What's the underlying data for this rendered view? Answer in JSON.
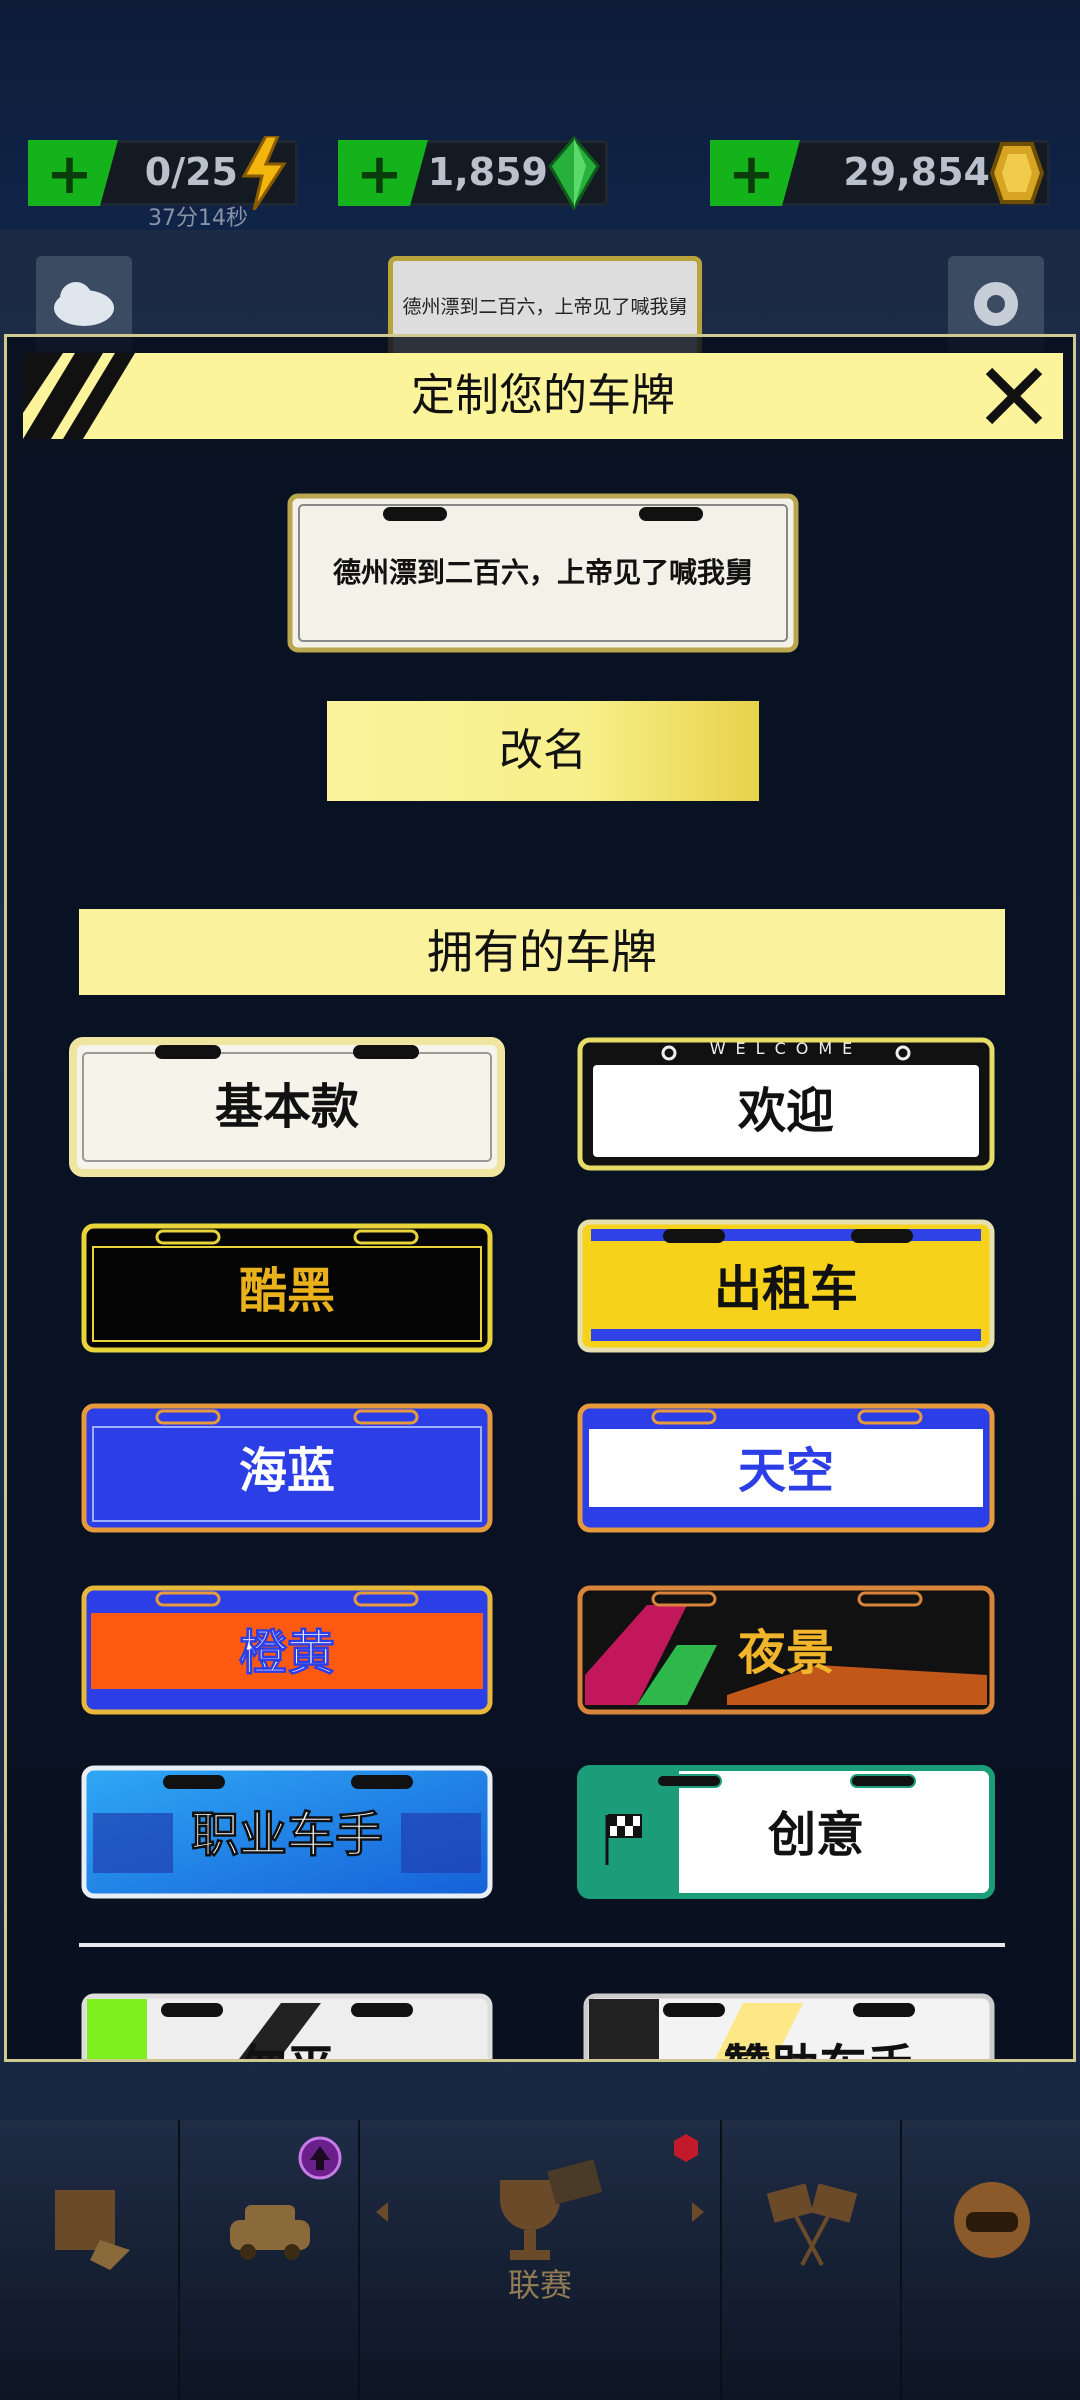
{
  "resources": [
    {
      "value": "0/25",
      "icon": "lightning-icon",
      "timer": "37分14秒"
    },
    {
      "value": "1,859",
      "icon": "green-gem-icon"
    },
    {
      "value": "29,854",
      "icon": "gold-coin-icon"
    }
  ],
  "background": {
    "plate_text": "德州漂到二百六，上帝见了喊我舅"
  },
  "dialog": {
    "title": "定制您的车牌",
    "current_plate_text": "德州漂到二百六，上帝见了喊我舅",
    "rename_label": "改名",
    "section_title": "拥有的车牌",
    "plates": [
      {
        "label": "基本款",
        "style": "basic",
        "selected": true
      },
      {
        "label": "欢迎",
        "style": "welcome",
        "header": "WELCOME"
      },
      {
        "label": "酷黑",
        "style": "black"
      },
      {
        "label": "出租车",
        "style": "taxi"
      },
      {
        "label": "海蓝",
        "style": "sea-blue"
      },
      {
        "label": "天空",
        "style": "sky"
      },
      {
        "label": "橙黄",
        "style": "orange"
      },
      {
        "label": "夜景",
        "style": "night"
      },
      {
        "label": "职业车手",
        "style": "pro-racer"
      },
      {
        "label": "创意",
        "style": "creative"
      }
    ],
    "partial_plates": [
      {
        "label": "勿平",
        "style": "partial-left"
      },
      {
        "label": "赞助车手",
        "style": "sponsor"
      }
    ]
  },
  "nav": {
    "tabs": [
      {
        "name": "shop",
        "icon": "shop-icon"
      },
      {
        "name": "garage",
        "icon": "car-icon"
      },
      {
        "name": "league",
        "icon": "trophy-icon",
        "label": "联赛"
      },
      {
        "name": "race",
        "icon": "checkered-flags-icon"
      },
      {
        "name": "profile",
        "icon": "helmet-icon"
      }
    ]
  },
  "colors": {
    "accent_yellow": "#fbf49a",
    "plus_green": "#14b21b",
    "plate_blue": "#2f43e6",
    "plate_orange": "#ff5a12",
    "plate_yellow": "#f7d21a"
  }
}
